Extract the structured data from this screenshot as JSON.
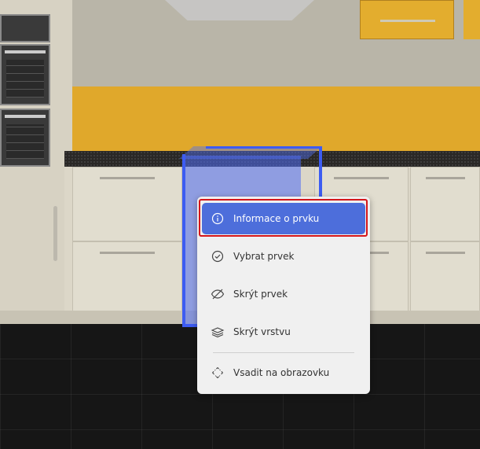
{
  "context_menu": {
    "items": [
      {
        "label": "Informace o prvku",
        "icon": "info-icon",
        "active": true
      },
      {
        "label": "Vybrat prvek",
        "icon": "check-circle-icon",
        "active": false
      },
      {
        "label": "Skrýt prvek",
        "icon": "eye-off-icon",
        "active": false
      },
      {
        "label": "Skrýt vrstvu",
        "icon": "layers-icon",
        "active": false
      },
      {
        "label": "Vsadit na obrazovku",
        "icon": "fit-screen-icon",
        "active": false
      }
    ]
  },
  "colors": {
    "accent": "#4d6edb",
    "highlight_border": "#d4161b",
    "selection": "#3d5cf2",
    "menu_bg": "#f0f0f0"
  }
}
